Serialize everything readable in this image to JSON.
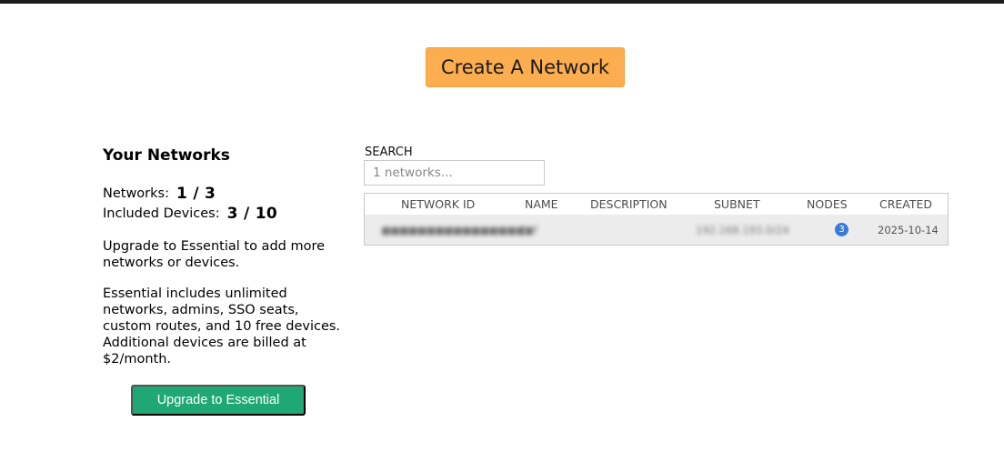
{
  "header": {
    "create_button_label": "Create A Network"
  },
  "sidebar": {
    "title": "Your Networks",
    "networks_label": "Networks:",
    "networks_value": "1 / 3",
    "devices_label": "Included Devices:",
    "devices_value": "3 / 10",
    "upgrade_text": "Upgrade to Essential to add more networks or devices.",
    "essential_text": "Essential includes unlimited networks, admins, SSO seats, custom routes, and 10 free devices. Additional devices are billed at $2/month.",
    "upgrade_button_label": "Upgrade to Essential"
  },
  "search": {
    "label": "SEARCH",
    "placeholder": "1 networks..."
  },
  "table": {
    "columns": [
      "NETWORK ID",
      "NAME",
      "DESCRIPTION",
      "SUBNET",
      "NODES",
      "CREATED"
    ],
    "rows": [
      {
        "network_id": "■■■■■■■■■■■■■■■■",
        "name": "l■f",
        "description": "",
        "subnet": "192.168.193.0/24",
        "nodes": "3",
        "created": "2025-10-14"
      }
    ]
  },
  "colors": {
    "create_button": "#fbad50",
    "upgrade_button": "#1fa775",
    "nodes_badge": "#3a7bd5",
    "row_bg": "#ececec"
  }
}
